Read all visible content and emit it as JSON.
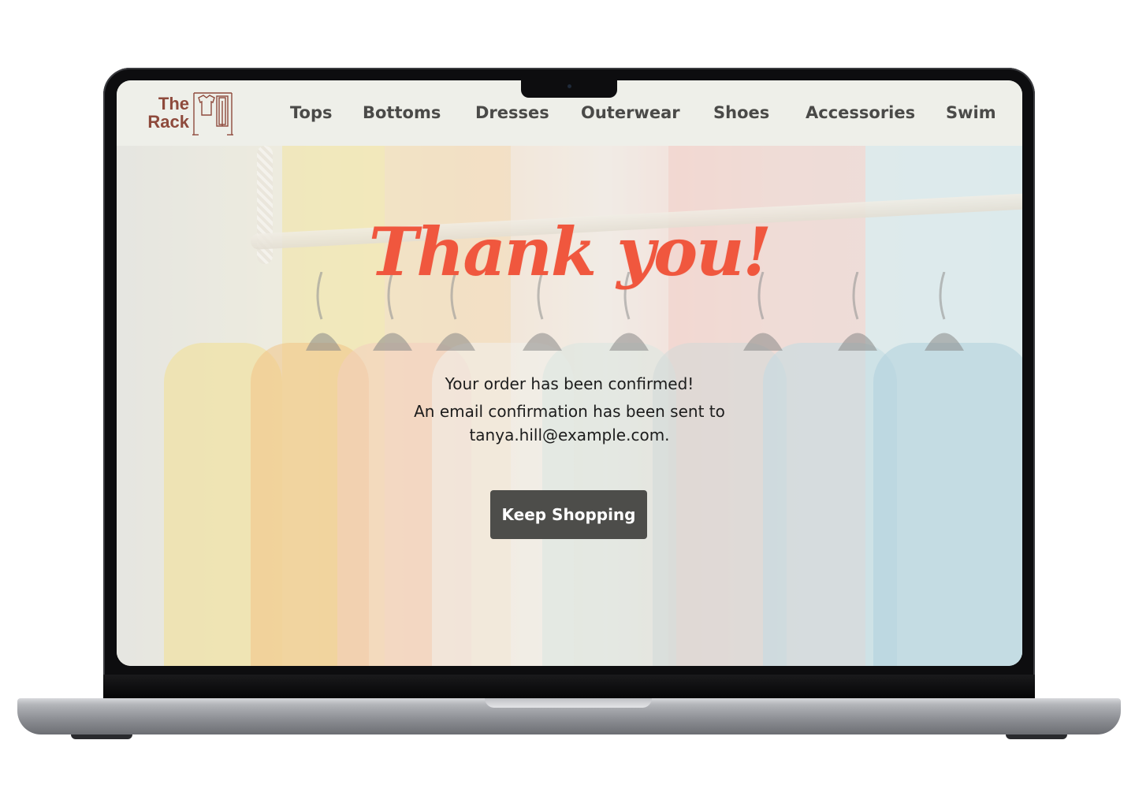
{
  "brand": {
    "name_line1": "The",
    "name_line2": "Rack",
    "logo_icon": "clothing-rack-icon",
    "color": "#8e4a3c"
  },
  "nav": {
    "items": [
      {
        "label": "Tops"
      },
      {
        "label": "Bottoms"
      },
      {
        "label": "Dresses"
      },
      {
        "label": "Outerwear"
      },
      {
        "label": "Shoes"
      },
      {
        "label": "Accessories"
      },
      {
        "label": "Swim"
      }
    ]
  },
  "confirmation": {
    "heading": "Thank you!",
    "line1": "Your order has been confirmed!",
    "line2": "An email confirmation has been sent to",
    "line3": "tanya.hill@example.com.",
    "button_label": "Keep Shopping"
  },
  "colors": {
    "accent": "#f0573e",
    "button_bg": "#4d4d4a",
    "header_bg": "#eeefe9"
  }
}
